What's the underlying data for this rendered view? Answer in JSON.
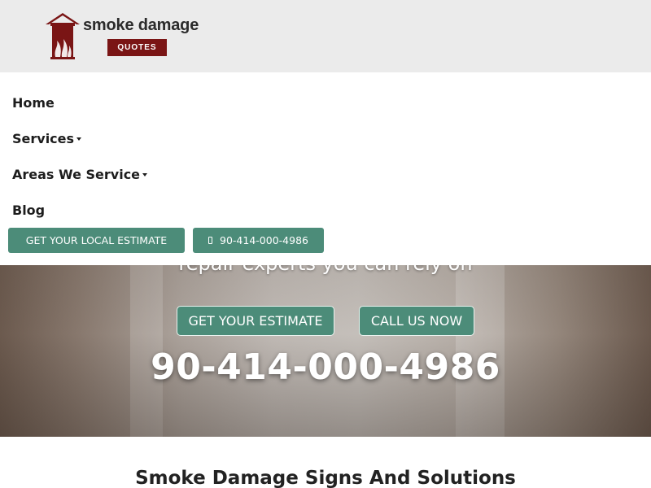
{
  "brand": {
    "name": "smoke damage",
    "badge": "QUOTES",
    "colors": {
      "primary": "#7a1515",
      "accent": "#4c8c79"
    }
  },
  "nav": {
    "items": [
      {
        "label": "Home",
        "has_dropdown": false
      },
      {
        "label": "Services",
        "has_dropdown": true
      },
      {
        "label": "Areas We Service",
        "has_dropdown": true
      },
      {
        "label": "Blog",
        "has_dropdown": false
      }
    ],
    "estimate_button": "GET YOUR LOCAL ESTIMATE",
    "phone_button": "90-414-000-4986",
    "phone_icon": "phone-icon"
  },
  "hero": {
    "tagline": "repair experts you can rely on",
    "estimate_button": "GET YOUR ESTIMATE",
    "call_button": "CALL US NOW",
    "phone": "90-414-000-4986"
  },
  "section": {
    "title": "Smoke Damage Signs And Solutions"
  }
}
